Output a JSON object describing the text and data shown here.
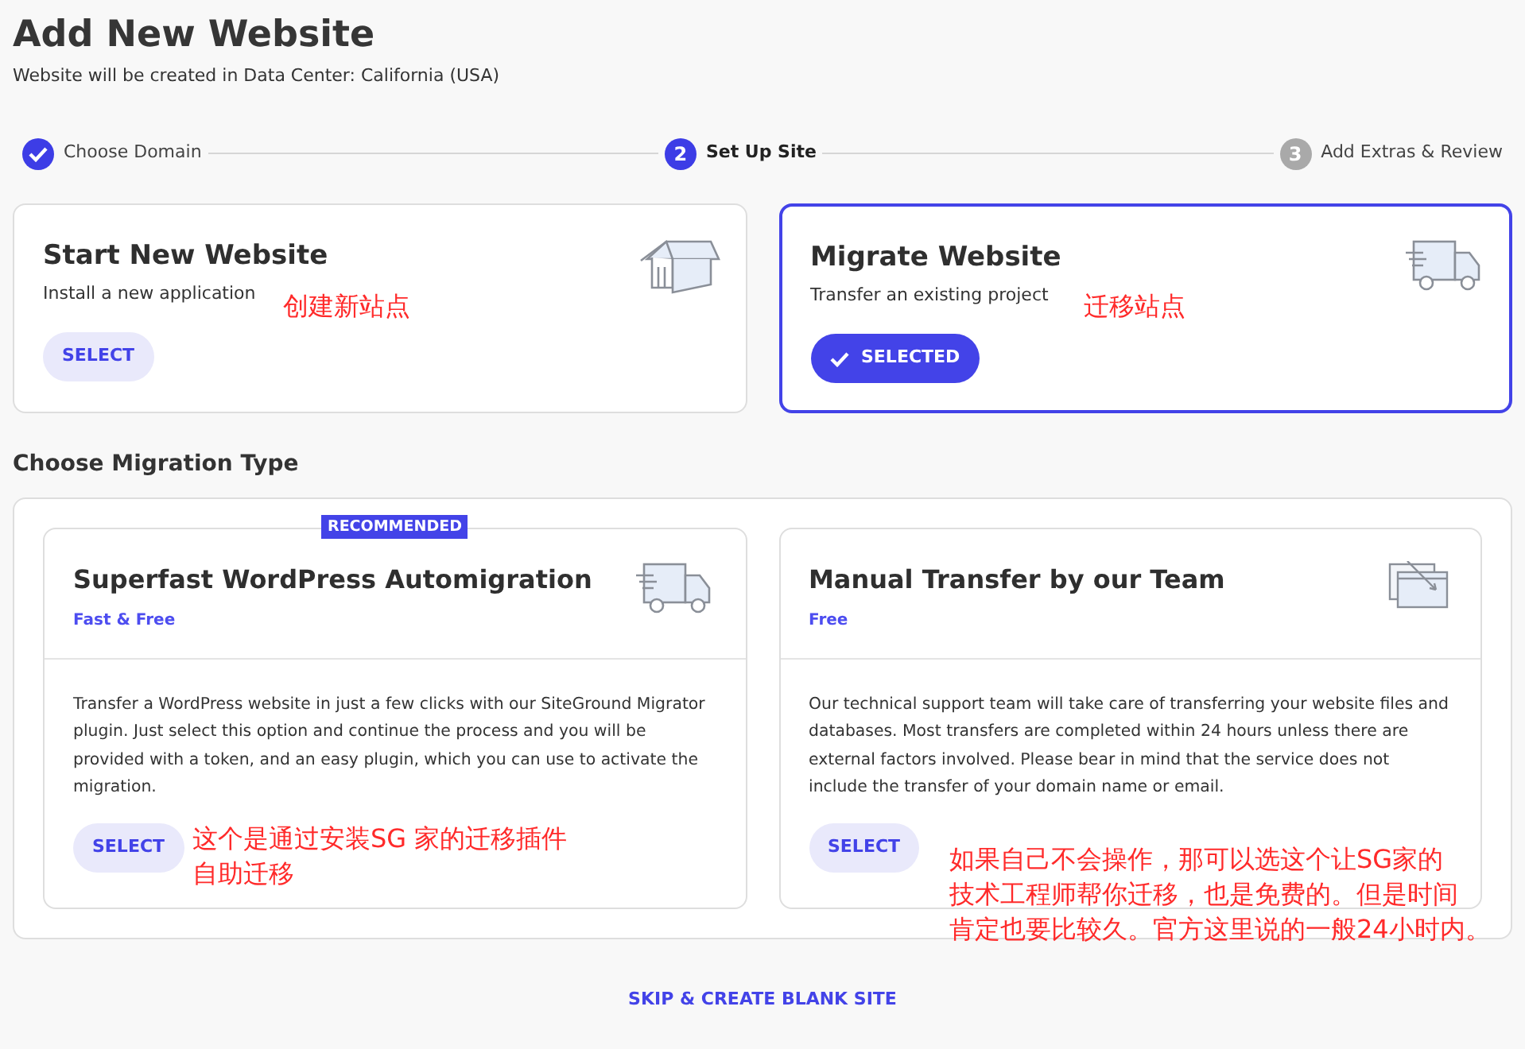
{
  "header": {
    "title": "Add New Website",
    "subtitle": "Website will be created in Data Center: California (USA)"
  },
  "steps": [
    {
      "label": "Choose Domain",
      "done": true,
      "selected": false
    },
    {
      "number": "2",
      "label": "Set Up Site",
      "done": false,
      "selected": true
    },
    {
      "number": "3",
      "label": "Add Extras & Review",
      "done": false,
      "selected": false
    }
  ],
  "site_options": [
    {
      "title": "Start New Website",
      "description": "Install a new application",
      "button": "SELECT",
      "selected": false,
      "kind": "house",
      "annotation": [
        "创建新站点"
      ]
    },
    {
      "title": "Migrate Website",
      "description": "Transfer an existing project",
      "button": "SELECTED",
      "selected": true,
      "kind": "truck",
      "annotation": [
        "迁移站点"
      ]
    }
  ],
  "migration": {
    "heading": "Choose Migration Type",
    "options": [
      {
        "title": "Superfast WordPress Automigration",
        "badge": "RECOMMENDED",
        "price": "Fast & Free",
        "kind": "truck",
        "description": "Transfer a WordPress website in just a few clicks with our SiteGround Migrator plugin. Just select this option and continue the process and you will be provided with a token, and an easy plugin, which you can use to activate the migration.",
        "button": "SELECT",
        "annotation": [
          "这个是通过安装SG 家的迁移插件",
          "自助迁移"
        ]
      },
      {
        "title": "Manual Transfer by our Team",
        "price": "Free",
        "kind": "windows",
        "description": "Our technical support team will take care of transferring your website files and databases. Most transfers are completed within 24 hours unless there are external factors involved. Please bear in mind that the service does not include the transfer of your domain name or email.",
        "button": "SELECT",
        "annotation": [
          "如果自己不会操作，那可以选这个让SG家的",
          "技术工程师帮你迁移，也是免费的。但是时间",
          "肯定也要比较久。官方这里说的一般24小时内。"
        ]
      }
    ]
  },
  "skip_link": "SKIP & CREATE BLANK SITE"
}
